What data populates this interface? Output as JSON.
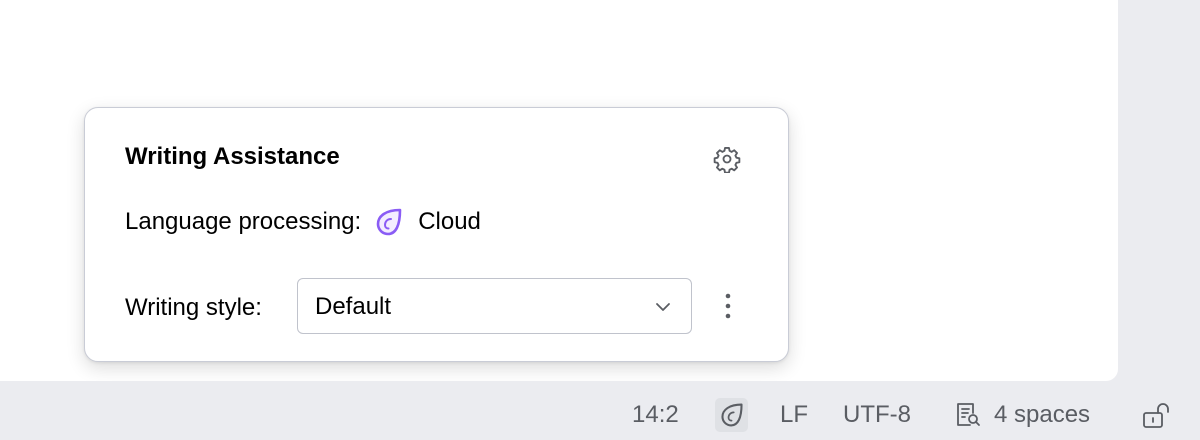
{
  "popup": {
    "title": "Writing Assistance",
    "language_processing_label": "Language processing:",
    "language_processing_value": "Cloud",
    "writing_style_label": "Writing style:",
    "writing_style_value": "Default",
    "icons": {
      "settings": "gear-icon",
      "cloud_processing": "grazie-cloud-icon",
      "dropdown": "chevron-down-icon",
      "more": "vertical-dots-icon"
    },
    "accent_color": "#8a5cf5"
  },
  "status_bar": {
    "position": "14:2",
    "line_separator": "LF",
    "encoding": "UTF-8",
    "indent": "4 spaces",
    "icons": {
      "writing_assistant": "grazie-icon",
      "indent": "document-search-icon",
      "lock": "unlock-icon"
    }
  }
}
